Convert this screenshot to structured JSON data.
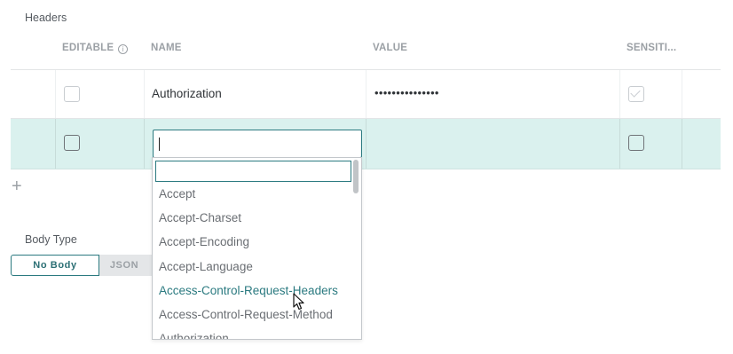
{
  "headers_section": {
    "label": "Headers"
  },
  "table": {
    "columns": {
      "editable": "EDITABLE",
      "name": "NAME",
      "value": "VALUE",
      "sensitive": "SENSITI..."
    },
    "rows": [
      {
        "editable": false,
        "name": "Authorization",
        "value": "•••••••••••••••",
        "sensitive": true
      },
      {
        "editable": false,
        "name": "",
        "value": "",
        "sensitive": false
      }
    ]
  },
  "dropdown": {
    "search_value": "",
    "options": [
      "Accept",
      "Accept-Charset",
      "Accept-Encoding",
      "Accept-Language",
      "Access-Control-Request-Headers",
      "Access-Control-Request-Method",
      "Authorization"
    ],
    "hovered_index": 4
  },
  "body_type": {
    "label": "Body Type",
    "options": [
      "No Body",
      "JSON"
    ],
    "selected": "No Body"
  },
  "icons": {
    "editable_info": "info-icon",
    "add_row": "plus-icon"
  },
  "colors": {
    "accent": "#2b7a80",
    "selected_row": "#daf1ee"
  }
}
